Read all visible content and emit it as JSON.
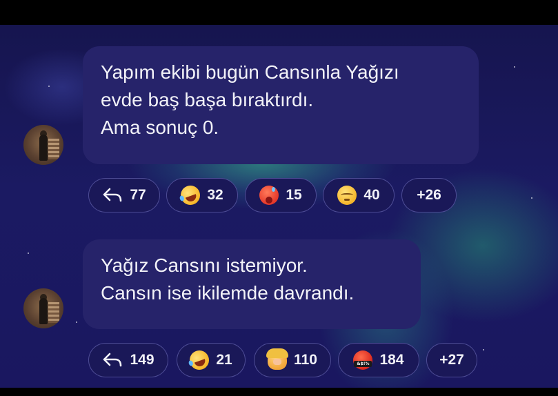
{
  "messages": [
    {
      "lines": [
        "Yapım ekibi bugün Cansınla Yağızı",
        "evde baş başa bıraktırdı.",
        "Ama sonuç 0."
      ],
      "reactions": {
        "replies": "77",
        "items": [
          {
            "emoji": "rolling-on-floor-laughing",
            "count": "32"
          },
          {
            "emoji": "hot-face",
            "count": "15"
          },
          {
            "emoji": "pensive-face",
            "count": "40"
          }
        ],
        "more": "+26"
      }
    },
    {
      "lines": [
        "Yağız Cansını istemiyor.",
        "Cansın ise ikilemde davrandı."
      ],
      "reactions": {
        "replies": "149",
        "items": [
          {
            "emoji": "rolling-on-floor-laughing",
            "count": "21"
          },
          {
            "emoji": "face-palm",
            "count": "110"
          },
          {
            "emoji": "face-with-symbols-on-mouth",
            "count": "184"
          }
        ],
        "more": "+27"
      }
    }
  ],
  "colors": {
    "bubble": "#26236a",
    "pill_background": "#1a1858",
    "background_top": "#16154f",
    "aurora_green": "#3cc896",
    "text": "#f2f2f8"
  }
}
